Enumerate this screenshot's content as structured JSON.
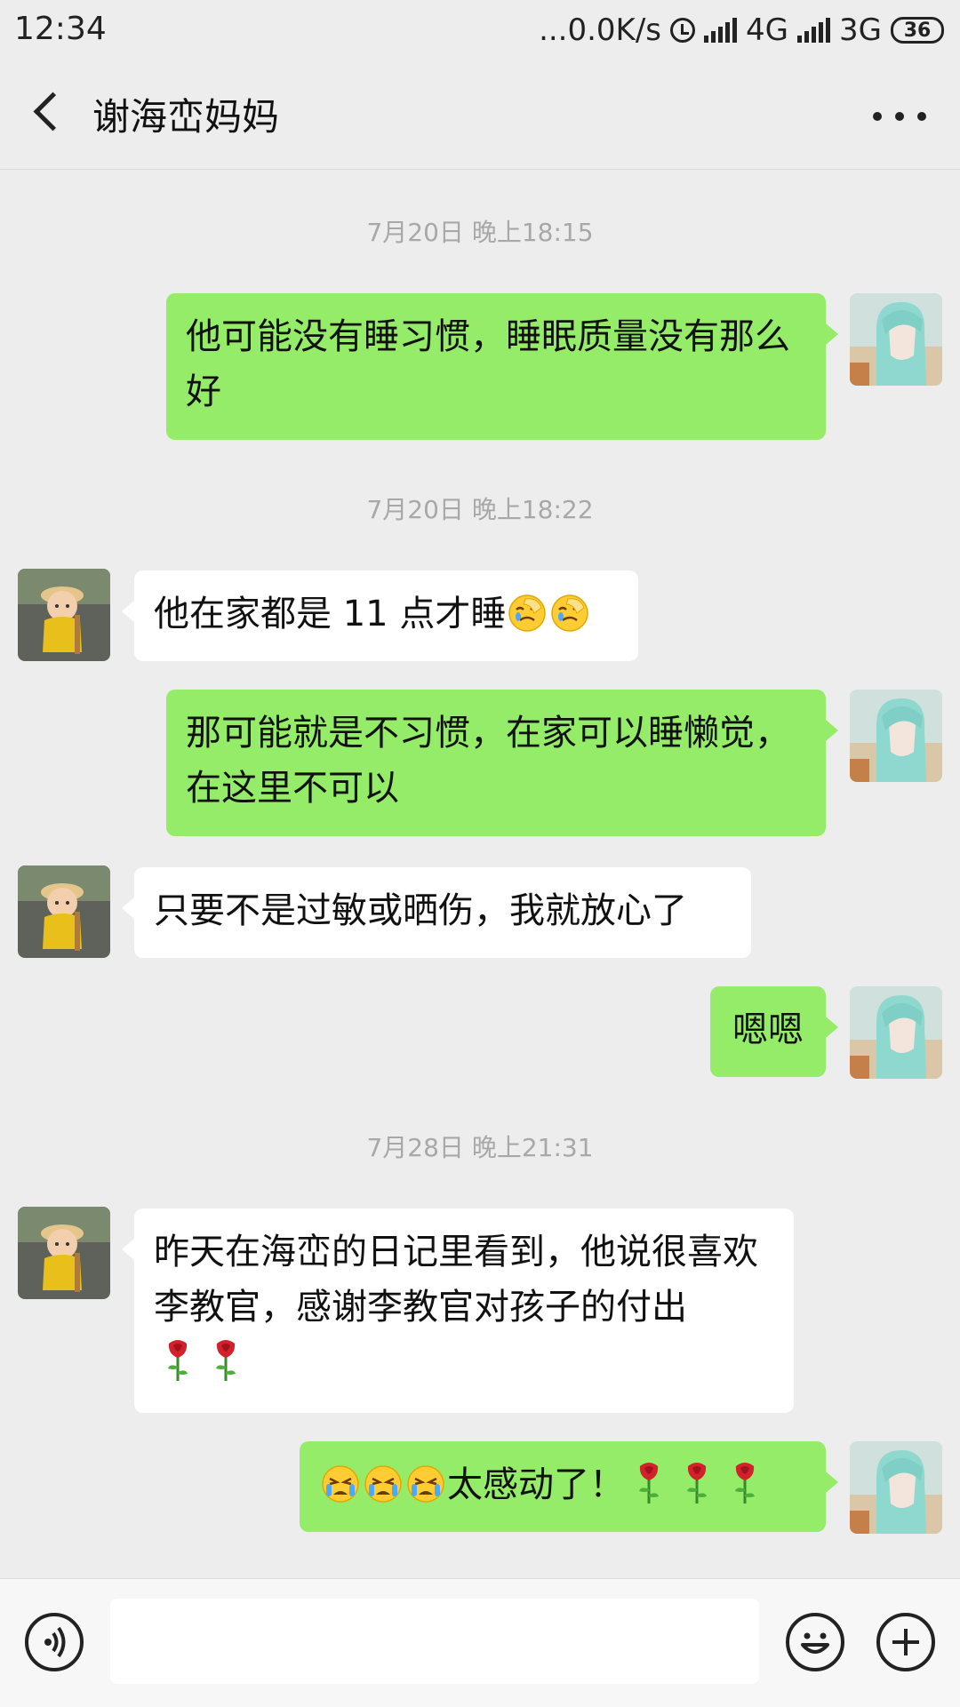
{
  "status_bar": {
    "time": "12:34",
    "network_speed": "...0.0K/s",
    "net1": "4G",
    "net2": "3G",
    "battery": "36"
  },
  "header": {
    "title": "谢海峦妈妈"
  },
  "messages": {
    "ts1": "7月20日 晚上18:15",
    "m1": "他可能没有睡习惯，睡眠质量没有那么好",
    "ts2": "7月20日 晚上18:22",
    "m2": "他在家都是 11 点才睡",
    "m3": "那可能就是不习惯，在家可以睡懒觉，在这里不可以",
    "m4": "只要不是过敏或晒伤，我就放心了",
    "m5": "嗯嗯",
    "ts3": "7月28日 晚上21:31",
    "m6": "昨天在海峦的日记里看到，他说很喜欢李教官，感谢李教官对孩子的付出",
    "m7": "太感动了！"
  },
  "icons": {
    "back": "back-arrow-icon",
    "more": "more-dots-icon",
    "voice": "voice-icon",
    "emoji": "emoji-face-icon",
    "add": "plus-icon",
    "facepalm_emoji": "facepalm-emoji-icon",
    "crying_emoji": "crying-emoji-icon",
    "rose": "rose-icon"
  },
  "colors": {
    "outgoing_bubble": "#95ec69",
    "incoming_bubble": "#ffffff",
    "background": "#ededed"
  }
}
